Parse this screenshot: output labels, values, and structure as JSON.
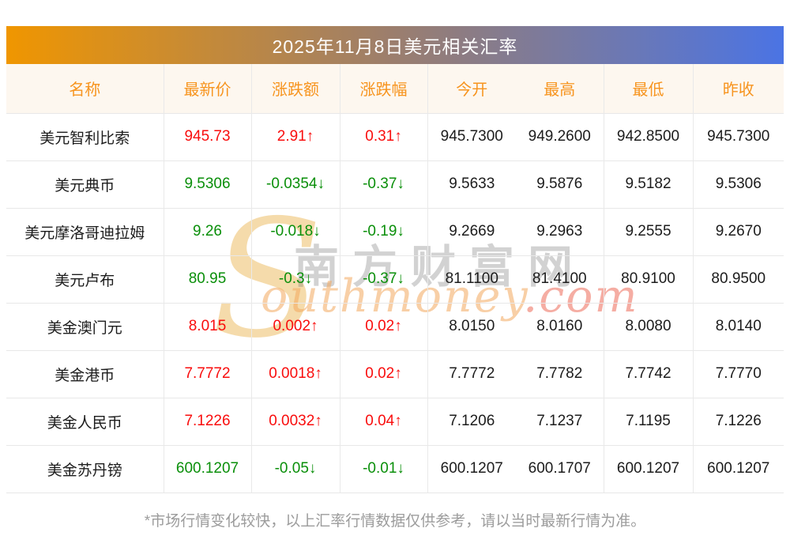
{
  "chart_data": {
    "type": "table",
    "title": "2025年11月8日美元相关汇率",
    "columns": [
      "名称",
      "最新价",
      "涨跌额",
      "涨跌幅",
      "今开",
      "最高",
      "最低",
      "昨收"
    ],
    "rows": [
      {
        "name": "美元智利比索",
        "latest": "945.73",
        "change": "2.91↑",
        "change_pct": "0.31↑",
        "open": "945.7300",
        "high": "949.2600",
        "low": "942.8500",
        "prev_close": "945.7300",
        "trend": "up"
      },
      {
        "name": "美元典币",
        "latest": "9.5306",
        "change": "-0.0354↓",
        "change_pct": "-0.37↓",
        "open": "9.5633",
        "high": "9.5876",
        "low": "9.5182",
        "prev_close": "9.5306",
        "trend": "down"
      },
      {
        "name": "美元摩洛哥迪拉姆",
        "latest": "9.26",
        "change": "-0.018↓",
        "change_pct": "-0.19↓",
        "open": "9.2669",
        "high": "9.2963",
        "low": "9.2555",
        "prev_close": "9.2670",
        "trend": "down"
      },
      {
        "name": "美元卢布",
        "latest": "80.95",
        "change": "-0.3↓",
        "change_pct": "-0.37↓",
        "open": "81.1100",
        "high": "81.4100",
        "low": "80.9100",
        "prev_close": "80.9500",
        "trend": "down"
      },
      {
        "name": "美金澳门元",
        "latest": "8.015",
        "change": "0.002↑",
        "change_pct": "0.02↑",
        "open": "8.0150",
        "high": "8.0160",
        "low": "8.0080",
        "prev_close": "8.0140",
        "trend": "up"
      },
      {
        "name": "美金港币",
        "latest": "7.7772",
        "change": "0.0018↑",
        "change_pct": "0.02↑",
        "open": "7.7772",
        "high": "7.7782",
        "low": "7.7742",
        "prev_close": "7.7770",
        "trend": "up"
      },
      {
        "name": "美金人民币",
        "latest": "7.1226",
        "change": "0.0032↑",
        "change_pct": "0.04↑",
        "open": "7.1206",
        "high": "7.1237",
        "low": "7.1195",
        "prev_close": "7.1226",
        "trend": "up"
      },
      {
        "name": "美金苏丹镑",
        "latest": "600.1207",
        "change": "-0.05↓",
        "change_pct": "-0.01↓",
        "open": "600.1207",
        "high": "600.1707",
        "low": "600.1207",
        "prev_close": "600.1207",
        "trend": "down"
      }
    ],
    "layout_hints": {
      "no_divider_between": [
        "今开",
        "最高"
      ],
      "grid": true
    }
  },
  "watermark": {
    "s": "S",
    "cn": "南方财富网",
    "en": "outhmoney",
    "en_suffix": ".com"
  },
  "footnote": "*市场行情变化较快，以上汇率行情数据仅供参考，请以当时最新行情为准。",
  "colors": {
    "up": "#f90d0d",
    "down": "#0a8f0a",
    "header_text": "#f7941e",
    "header_bg": "#fdf7ef",
    "title_gradient_start": "#f09600",
    "title_gradient_end": "#4b74e4",
    "footnote_text": "#9c9c9c"
  }
}
